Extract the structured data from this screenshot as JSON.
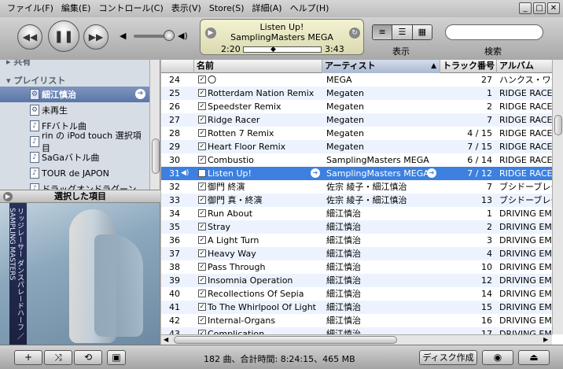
{
  "menu": [
    "ファイル(F)",
    "編集(E)",
    "コントロール(C)",
    "表示(V)",
    "Store(S)",
    "詳細(A)",
    "ヘルプ(H)"
  ],
  "window_buttons": [
    "_",
    "□",
    "✕"
  ],
  "toolbar": {
    "prev_icon": "◀◀",
    "play_icon": "❚❚",
    "next_icon": "▶▶",
    "vol_low_icon": "◀",
    "vol_high_icon": "◀)"
  },
  "now_playing": {
    "title": "Listen Up!",
    "artist": "SamplingMasters MEGA",
    "elapsed": "2:20",
    "remaining": "3:43",
    "progress": 0.38
  },
  "view": {
    "label": "表示",
    "buttons": [
      "≡",
      "☰",
      "▦"
    ],
    "active_index": 0
  },
  "search": {
    "label": "検索",
    "placeholder": ""
  },
  "sidebar": {
    "partial_header": "共有",
    "section": "プレイリスト",
    "items": [
      {
        "label": "細江慎治",
        "selected": true
      },
      {
        "label": "未再生",
        "selected": false
      },
      {
        "label": "FFバトル曲",
        "selected": false
      },
      {
        "label": "rin の iPod touch 選択項目",
        "selected": false
      },
      {
        "label": "SaGaバトル曲",
        "selected": false
      },
      {
        "label": "TOUR de JAPON",
        "selected": false
      },
      {
        "label": "ドラッグオンドラグーン",
        "selected": false
      }
    ]
  },
  "artwork": {
    "header": "選択した項目",
    "strip_text": "リッジレーサー ダンスパレードハーフ ／ SAMPLING MASTERS"
  },
  "columns": {
    "name": "名前",
    "artist": "アーティスト",
    "track": "トラック番号",
    "album": "アルバム"
  },
  "tracks": [
    {
      "num": "24",
      "name": "〇",
      "artist": "MEGA",
      "track": "27",
      "album": "ハンクス・ワークス"
    },
    {
      "num": "25",
      "name": "Rotterdam Nation Remix",
      "artist": "Megaten",
      "track": "1",
      "album": "RIDGE RACER"
    },
    {
      "num": "26",
      "name": "Speedster Remix",
      "artist": "Megaten",
      "track": "2",
      "album": "RIDGE RACER"
    },
    {
      "num": "27",
      "name": "Ridge Racer",
      "artist": "Megaten",
      "track": "7",
      "album": "RIDGE RACER"
    },
    {
      "num": "28",
      "name": "Rotten 7 Remix",
      "artist": "Megaten",
      "track": "4 / 15",
      "album": "RIDGE RACER"
    },
    {
      "num": "29",
      "name": "Heart Floor Remix",
      "artist": "Megaten",
      "track": "7 / 15",
      "album": "RIDGE RACER"
    },
    {
      "num": "30",
      "name": "Combustio",
      "artist": "SamplingMasters MEGA",
      "track": "6 / 14",
      "album": "RIDGE RACER"
    },
    {
      "num": "31",
      "name": "Listen Up!",
      "artist": "SamplingMasters MEGA",
      "track": "7 / 12",
      "album": "RIDGE RACER",
      "playing": true
    },
    {
      "num": "32",
      "name": "御門 終演",
      "artist": "佐宗 綾子・細江慎治",
      "track": "7",
      "album": "ブシドーブレード"
    },
    {
      "num": "33",
      "name": "御門 真・終演",
      "artist": "佐宗 綾子・細江慎治",
      "track": "13",
      "album": "ブシドーブレード"
    },
    {
      "num": "34",
      "name": "Run About",
      "artist": "細江慎治",
      "track": "1",
      "album": "DRIVING EMOTION"
    },
    {
      "num": "35",
      "name": "Stray",
      "artist": "細江慎治",
      "track": "2",
      "album": "DRIVING EMOTION"
    },
    {
      "num": "36",
      "name": "A Light Turn",
      "artist": "細江慎治",
      "track": "3",
      "album": "DRIVING EMOTION"
    },
    {
      "num": "37",
      "name": "Heavy Way",
      "artist": "細江慎治",
      "track": "4",
      "album": "DRIVING EMOTION"
    },
    {
      "num": "38",
      "name": "Pass Through",
      "artist": "細江慎治",
      "track": "10",
      "album": "DRIVING EMOTION"
    },
    {
      "num": "39",
      "name": "Insomnia Operation",
      "artist": "細江慎治",
      "track": "12",
      "album": "DRIVING EMOTION"
    },
    {
      "num": "40",
      "name": "Recollections Of Sepia",
      "artist": "細江慎治",
      "track": "14",
      "album": "DRIVING EMOTION"
    },
    {
      "num": "41",
      "name": "To The Whirlpool Of Light",
      "artist": "細江慎治",
      "track": "15",
      "album": "DRIVING EMOTION"
    },
    {
      "num": "42",
      "name": "Internal-Organs",
      "artist": "細江慎治",
      "track": "16",
      "album": "DRIVING EMOTION"
    },
    {
      "num": "43",
      "name": "Complication",
      "artist": "細江慎治",
      "track": "17",
      "album": "DRIVING EMOTION"
    }
  ],
  "bottom": {
    "add_icon": "+",
    "shuffle_icon": "⤨",
    "repeat_icon": "⟲",
    "show_art_icon": "▣",
    "status": "182 曲、合計時間: 8:24:15、465 MB",
    "burn_label": "ディスク作成",
    "eye_icon": "◉",
    "eject_icon": "⏏"
  },
  "colors": {
    "selection": "#3d80df",
    "sidebar_bg": "#d6dde5",
    "lcd_bg": "#f4f3d2"
  }
}
